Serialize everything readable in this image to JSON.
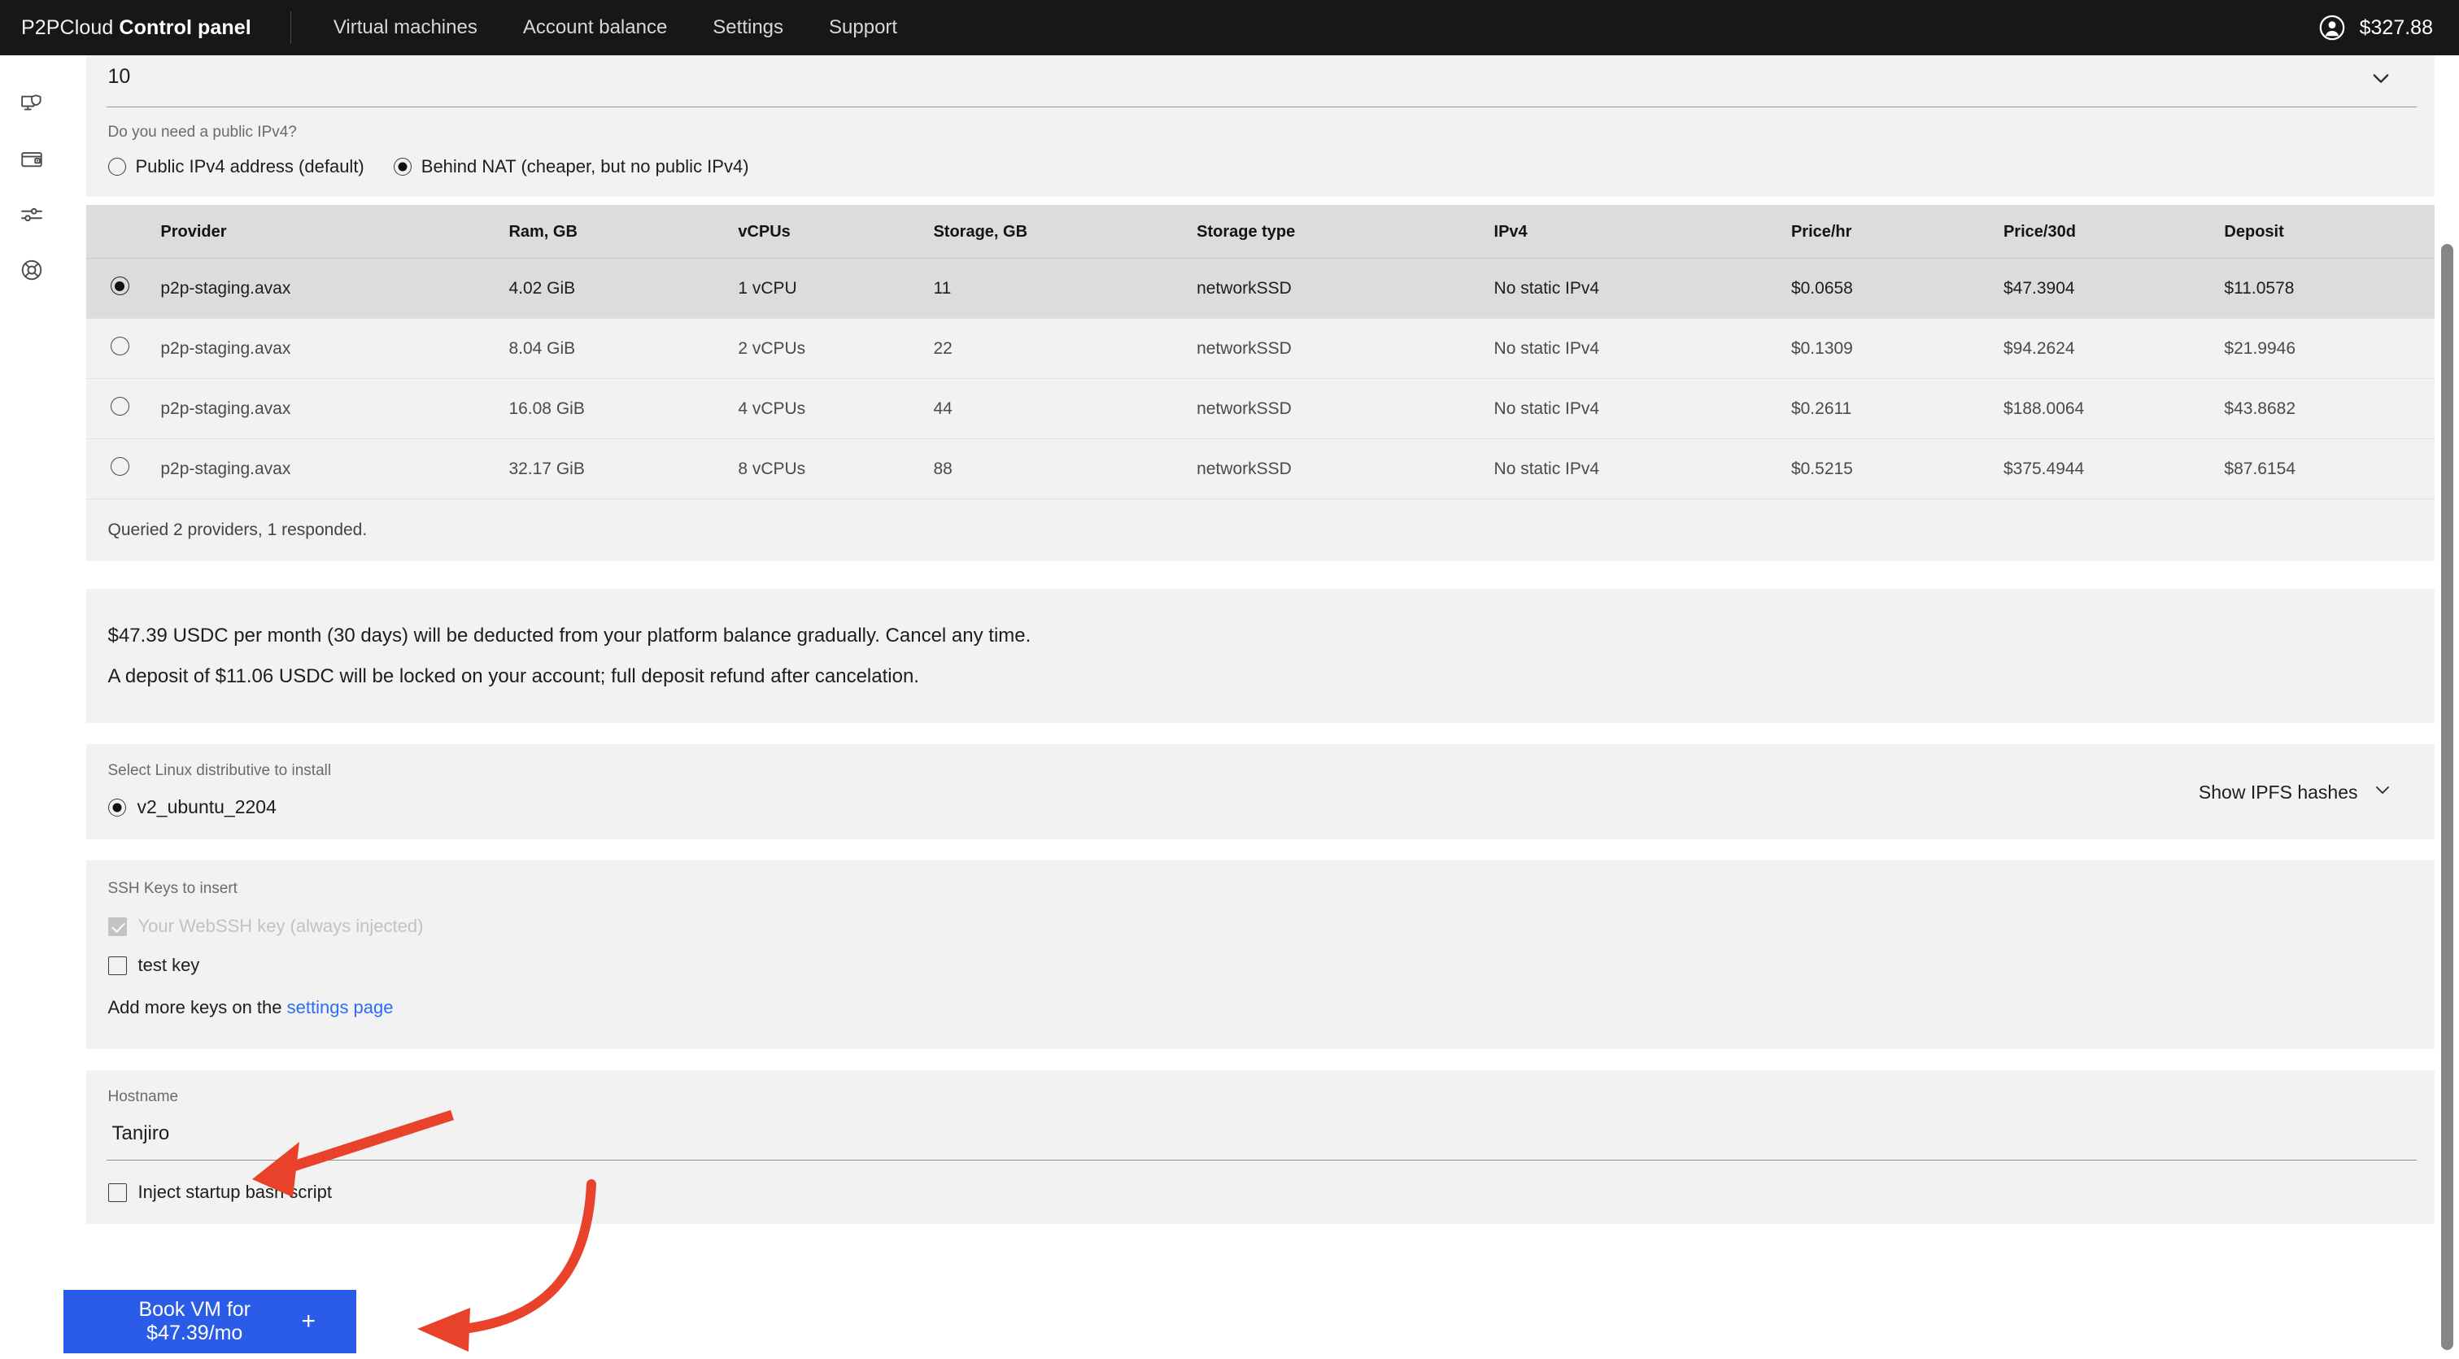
{
  "header": {
    "brand_light": "P2PCloud ",
    "brand_bold": "Control panel",
    "nav": [
      {
        "label": "Virtual machines"
      },
      {
        "label": "Account balance"
      },
      {
        "label": "Settings"
      },
      {
        "label": "Support"
      }
    ],
    "balance": "$327.88",
    "avatar_icon": "user-circle-icon"
  },
  "sidebar": {
    "items": [
      {
        "icon": "monitor-shield-icon",
        "name": "virtual-machines"
      },
      {
        "icon": "wallet-icon",
        "name": "account-balance"
      },
      {
        "icon": "sliders-icon",
        "name": "settings"
      },
      {
        "icon": "lifebuoy-icon",
        "name": "support"
      }
    ]
  },
  "dropdown": {
    "value": "10",
    "chevron_icon": "chevron-down-icon"
  },
  "ipv4": {
    "question": "Do you need a public IPv4?",
    "options": [
      {
        "label": "Public IPv4 address (default)",
        "checked": false
      },
      {
        "label": "Behind NAT (cheaper, but no public IPv4)",
        "checked": true
      }
    ]
  },
  "providers_table": {
    "columns": [
      "Provider",
      "Ram, GB",
      "vCPUs",
      "Storage, GB",
      "Storage type",
      "IPv4",
      "Price/hr",
      "Price/30d",
      "Deposit"
    ],
    "rows": [
      {
        "selected": true,
        "provider": "p2p-staging.avax",
        "ram": "4.02 GiB",
        "vcpus": "1 vCPU",
        "storage": "11",
        "storage_type": "networkSSD",
        "ipv4": "No static IPv4",
        "price_hr": "$0.0658",
        "price_30d": "$47.3904",
        "deposit": "$11.0578"
      },
      {
        "selected": false,
        "provider": "p2p-staging.avax",
        "ram": "8.04 GiB",
        "vcpus": "2 vCPUs",
        "storage": "22",
        "storage_type": "networkSSD",
        "ipv4": "No static IPv4",
        "price_hr": "$0.1309",
        "price_30d": "$94.2624",
        "deposit": "$21.9946"
      },
      {
        "selected": false,
        "provider": "p2p-staging.avax",
        "ram": "16.08 GiB",
        "vcpus": "4 vCPUs",
        "storage": "44",
        "storage_type": "networkSSD",
        "ipv4": "No static IPv4",
        "price_hr": "$0.2611",
        "price_30d": "$188.0064",
        "deposit": "$43.8682"
      },
      {
        "selected": false,
        "provider": "p2p-staging.avax",
        "ram": "32.17 GiB",
        "vcpus": "8 vCPUs",
        "storage": "88",
        "storage_type": "networkSSD",
        "ipv4": "No static IPv4",
        "price_hr": "$0.5215",
        "price_30d": "$375.4944",
        "deposit": "$87.6154"
      }
    ],
    "footer": "Queried 2 providers, 1 responded."
  },
  "pricing_notice": {
    "line1": "$47.39 USDC per month (30 days) will be deducted from your platform balance gradually. Cancel any time.",
    "line2": "A deposit of $11.06 USDC will be locked on your account; full deposit refund after cancelation."
  },
  "distro": {
    "label": "Select Linux distributive to install",
    "option": "v2_ubuntu_2204",
    "option_checked": true,
    "ipfs_toggle": "Show IPFS hashes",
    "ipfs_chevron_icon": "chevron-down-icon"
  },
  "ssh": {
    "label": "SSH Keys to insert",
    "keys": [
      {
        "label": "Your WebSSH key (always injected)",
        "checked": true,
        "disabled": true
      },
      {
        "label": "test key",
        "checked": false,
        "disabled": false
      }
    ],
    "add_more_prefix": "Add more keys on the ",
    "add_more_link": "settings page"
  },
  "hostname": {
    "label": "Hostname",
    "value": "Tanjiro",
    "placeholder": "Hostname"
  },
  "inject_script": {
    "label": "Inject startup bash script",
    "checked": false
  },
  "book_button": {
    "label": "Book VM for $47.39/mo",
    "plus": "+"
  },
  "annotations": {
    "arrow_color": "#E8432A",
    "arrows": [
      {
        "name": "arrow-to-hostname",
        "style": "straight"
      },
      {
        "name": "arrow-to-book-button",
        "style": "curved"
      }
    ]
  },
  "scrollbar": {
    "name": "vertical-scrollbar"
  }
}
